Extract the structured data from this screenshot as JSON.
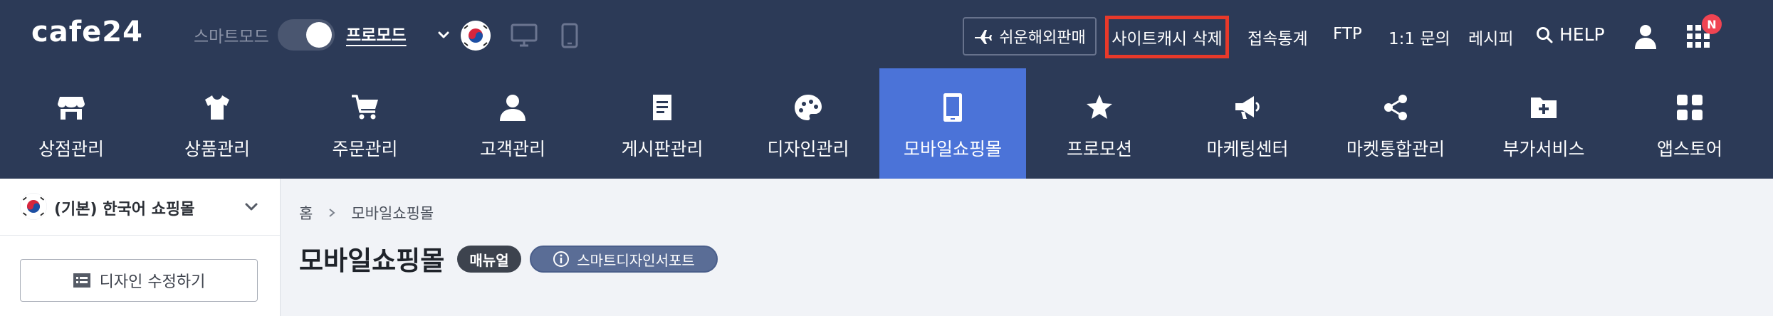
{
  "topbar": {
    "logo": "cafe24",
    "mode_label": "스마트모드",
    "mode_current": "프로모드",
    "global_sale_label": "쉬운해외판매",
    "cache_delete_label": "사이트캐시 삭제",
    "links": [
      "접속통계",
      "FTP",
      "1:1 문의",
      "레시피"
    ],
    "help_label": "HELP",
    "apps_badge": "N"
  },
  "nav": {
    "items": [
      {
        "label": "상점관리",
        "icon": "store-icon"
      },
      {
        "label": "상품관리",
        "icon": "tshirt-icon"
      },
      {
        "label": "주문관리",
        "icon": "cart-icon"
      },
      {
        "label": "고객관리",
        "icon": "person-icon"
      },
      {
        "label": "게시판관리",
        "icon": "board-icon"
      },
      {
        "label": "디자인관리",
        "icon": "palette-icon"
      },
      {
        "label": "모바일쇼핑몰",
        "icon": "mobile-icon"
      },
      {
        "label": "프로모션",
        "icon": "star-icon"
      },
      {
        "label": "마케팅센터",
        "icon": "megaphone-icon"
      },
      {
        "label": "마켓통합관리",
        "icon": "share-icon"
      },
      {
        "label": "부가서비스",
        "icon": "folder-plus-icon"
      },
      {
        "label": "앱스토어",
        "icon": "grid-icon"
      }
    ],
    "active_index": 6
  },
  "sidebar": {
    "shop_label": "(기본) 한국어 쇼핑몰",
    "design_button_label": "디자인 수정하기"
  },
  "content": {
    "breadcrumb": [
      "홈",
      "모바일쇼핑몰"
    ],
    "title": "모바일쇼핑몰",
    "manual_label": "매뉴얼",
    "support_label": "스마트디자인서포트"
  },
  "colors": {
    "topbar_bg": "#2c3a57",
    "active_nav": "#4b73d8",
    "highlight_border": "#e8392a",
    "badge": "#f04452"
  }
}
